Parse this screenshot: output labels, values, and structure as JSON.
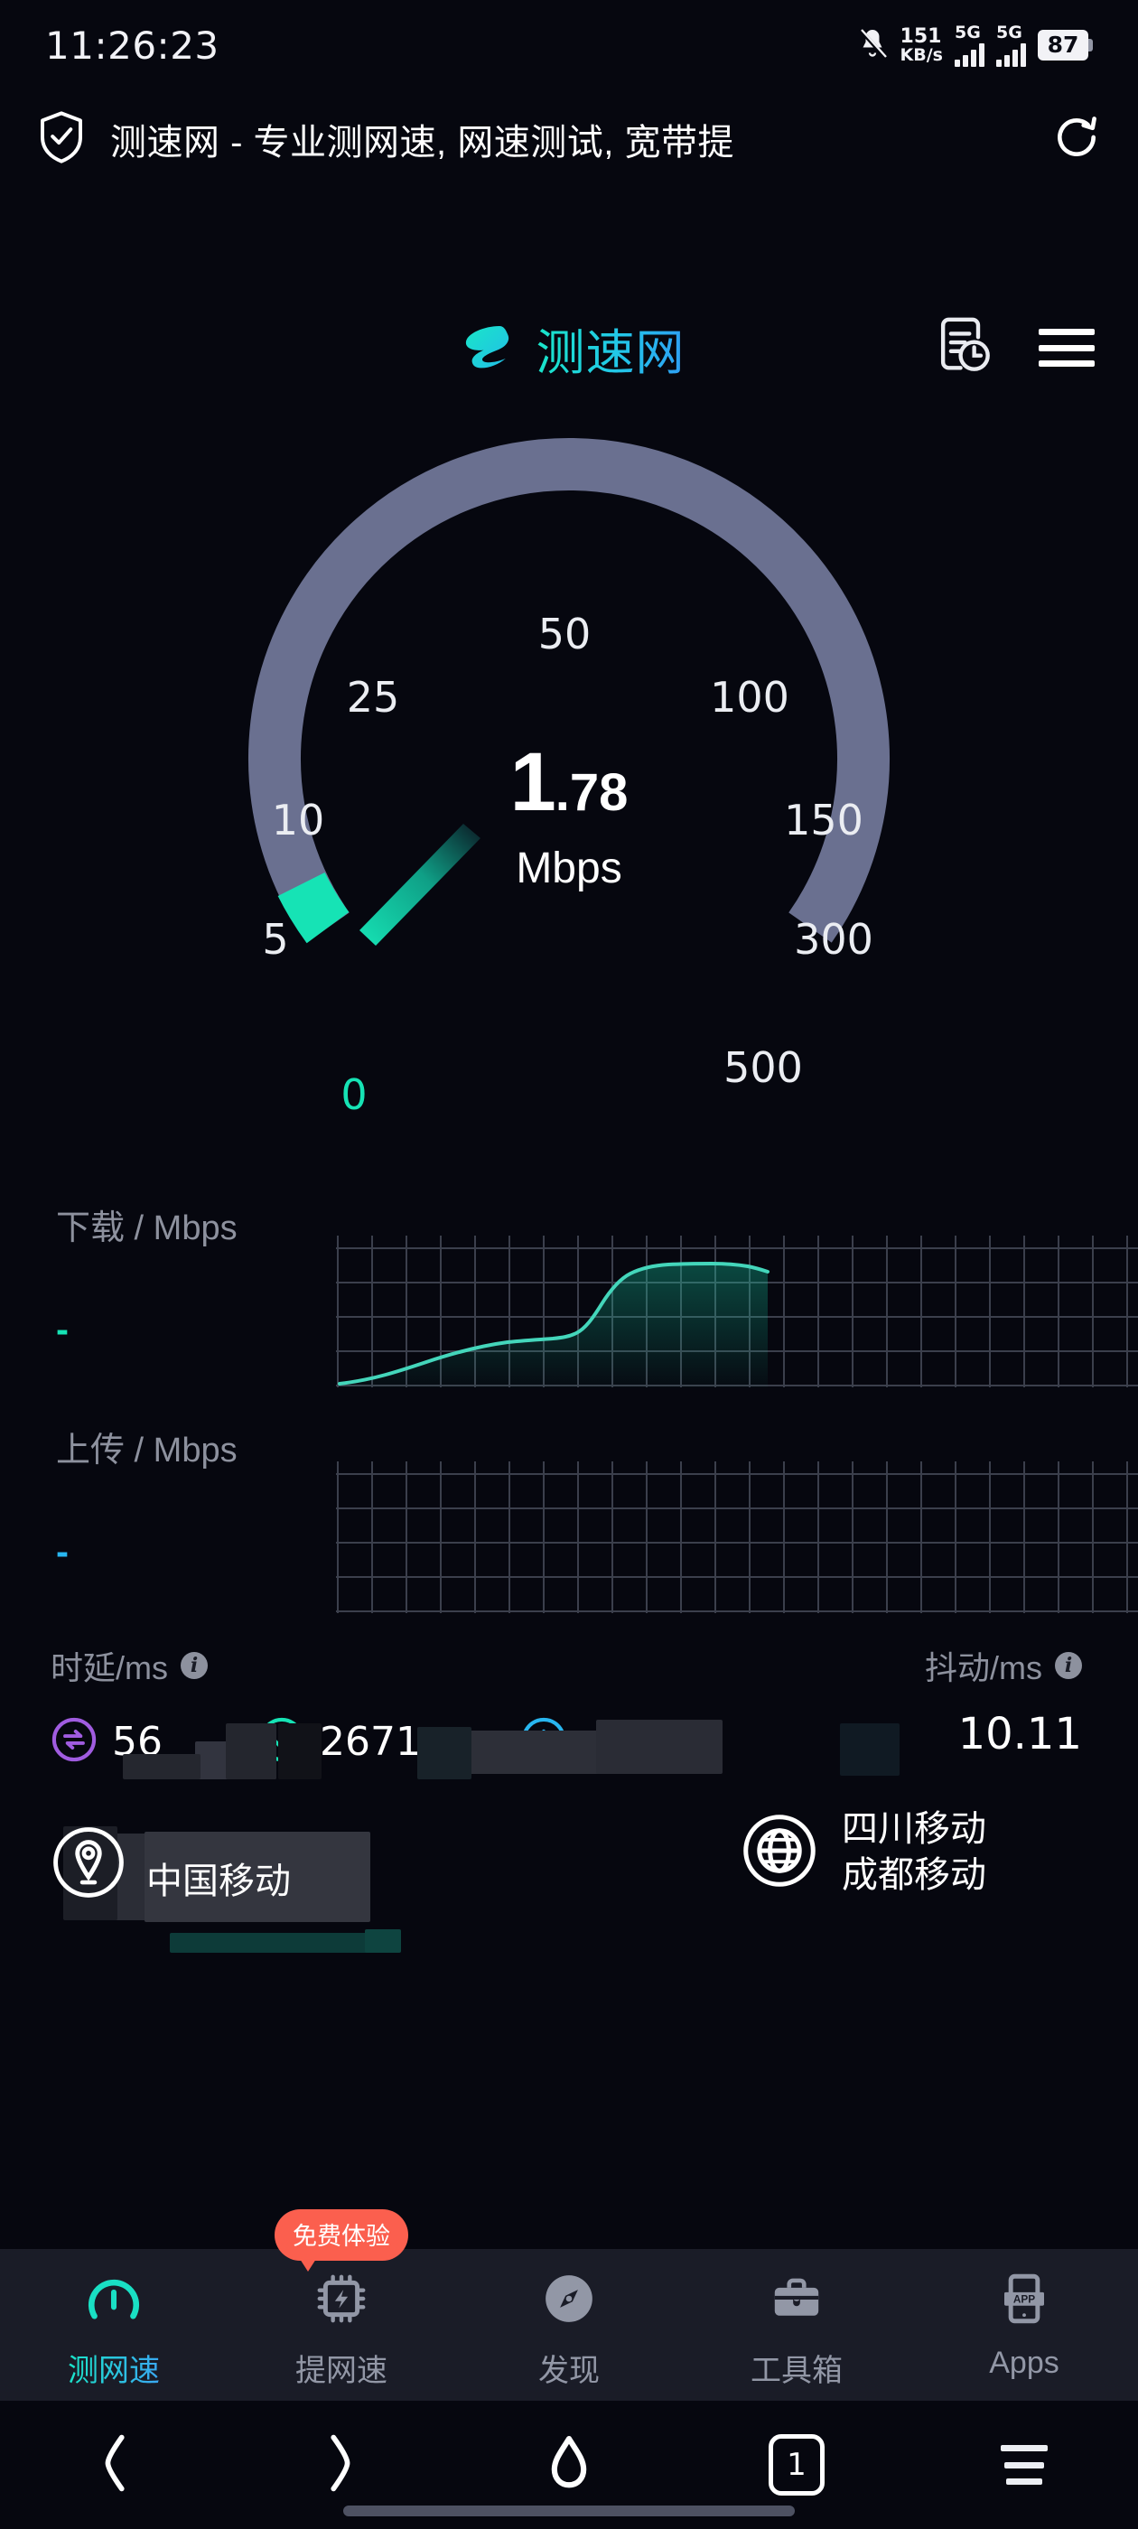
{
  "status_bar": {
    "time": "11:26:23",
    "bell_icon": "bell-muted-icon",
    "net_speed_value": "151",
    "net_speed_unit": "KB/s",
    "sim1_label": "5G",
    "sim2_label": "5G",
    "battery_percent": "87"
  },
  "browser": {
    "shield_icon": "shield-check-icon",
    "page_title": "测速网 - 专业测网速, 网速测试, 宽带提",
    "refresh_icon": "refresh-icon"
  },
  "app_header": {
    "logo_icon": "speedtest-logo-icon",
    "logo_text": "测速网",
    "history_icon": "history-record-icon",
    "menu_icon": "hamburger-menu-icon"
  },
  "gauge": {
    "ticks": [
      "0",
      "5",
      "10",
      "25",
      "50",
      "100",
      "150",
      "300",
      "500"
    ],
    "reading_int": "1",
    "reading_dec": ".78",
    "unit": "Mbps",
    "arc_color": "#6a7090",
    "active_color": "#16e3b5",
    "needle_value": 1.78
  },
  "download": {
    "label": "下载 / Mbps",
    "value": "-",
    "color": "#16e3b5"
  },
  "upload": {
    "label": "上传 / Mbps",
    "value": "-",
    "color": "#28b6f0"
  },
  "latency": {
    "heading": "时延/ms",
    "info_glyph": "i",
    "items": [
      {
        "icon": "exchange-idle-icon",
        "icon_color": "#a05ce0",
        "value": "56"
      },
      {
        "icon": "download-latency-icon",
        "icon_color": "#16e3b5",
        "value": "2671"
      },
      {
        "icon": "upload-latency-icon",
        "icon_color": "#28b6f0",
        "value": "-"
      }
    ]
  },
  "jitter": {
    "heading": "抖动/ms",
    "info_glyph": "i",
    "value": "10.11"
  },
  "isp": {
    "location_icon": "location-pin-icon",
    "carrier": "中国移动",
    "globe_icon": "globe-icon",
    "server_line1": "四川移动",
    "server_line2": "成都移动"
  },
  "tabs": [
    {
      "label": "测网速",
      "icon": "speed-gauge-icon",
      "active": true,
      "badge": ""
    },
    {
      "label": "提网速",
      "icon": "chip-boost-icon",
      "active": false,
      "badge": "免费体验"
    },
    {
      "label": "发现",
      "icon": "compass-icon",
      "active": false,
      "badge": ""
    },
    {
      "label": "工具箱",
      "icon": "toolbox-icon",
      "active": false,
      "badge": ""
    },
    {
      "label": "Apps",
      "icon": "app-phone-icon",
      "active": false,
      "badge": ""
    }
  ],
  "nav_bar": {
    "back_icon": "chevron-left-icon",
    "forward_icon": "chevron-right-icon",
    "home_icon": "home-icon",
    "tab_count": "1",
    "menu_icon": "nav-menu-icon"
  },
  "chart_data": [
    {
      "type": "area",
      "name": "download",
      "title": "下载 / Mbps",
      "color": "#16e3b5",
      "grid": true,
      "xlim": [
        0,
        100
      ],
      "ylim": [
        0,
        1
      ],
      "x": [
        0,
        4,
        9,
        14,
        19,
        24,
        29,
        33,
        36,
        39,
        41,
        43,
        45,
        47,
        50,
        53,
        56,
        59,
        62,
        64,
        66,
        68,
        70,
        72,
        73.5,
        74,
        74.2
      ],
      "y": [
        0.02,
        0.05,
        0.1,
        0.16,
        0.23,
        0.31,
        0.38,
        0.42,
        0.43,
        0.435,
        0.44,
        0.45,
        0.48,
        0.56,
        0.68,
        0.79,
        0.87,
        0.92,
        0.95,
        0.965,
        0.97,
        0.972,
        0.97,
        0.955,
        0.95,
        0.93,
        0.0
      ]
    },
    {
      "type": "area",
      "name": "upload",
      "title": "上传 / Mbps",
      "color": "#28b6f0",
      "grid": true,
      "xlim": [
        0,
        100
      ],
      "ylim": [
        0,
        1
      ],
      "x": [],
      "y": []
    }
  ]
}
